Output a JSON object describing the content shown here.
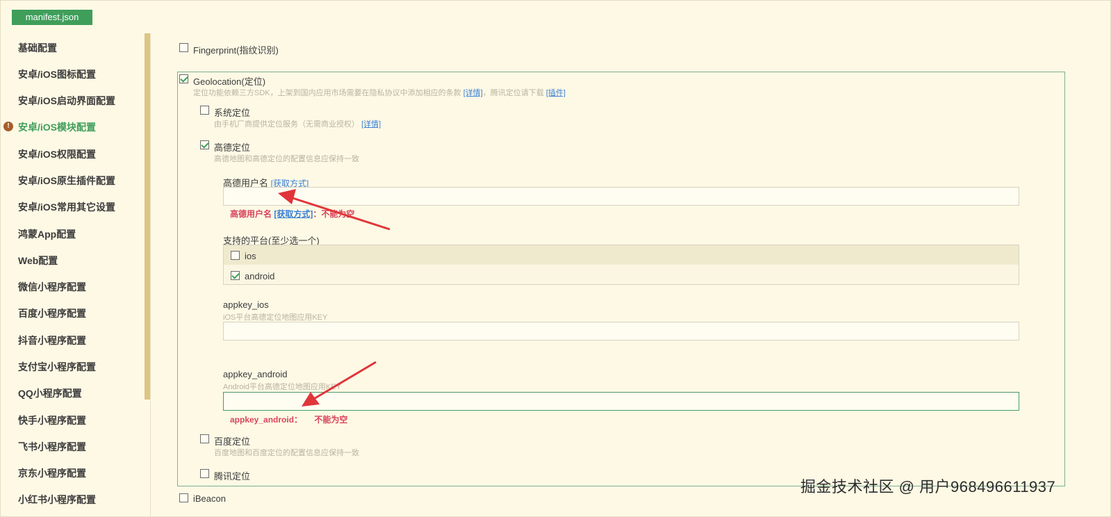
{
  "tab": {
    "label": "manifest.json"
  },
  "sidebar": {
    "items": [
      {
        "label": "基础配置"
      },
      {
        "label": "安卓/iOS图标配置"
      },
      {
        "label": "安卓/iOS启动界面配置"
      },
      {
        "label": "安卓/iOS模块配置",
        "active": true,
        "warning": "!"
      },
      {
        "label": "安卓/iOS权限配置"
      },
      {
        "label": "安卓/iOS原生插件配置"
      },
      {
        "label": "安卓/iOS常用其它设置"
      },
      {
        "label": "鸿蒙App配置"
      },
      {
        "label": "Web配置"
      },
      {
        "label": "微信小程序配置"
      },
      {
        "label": "百度小程序配置"
      },
      {
        "label": "抖音小程序配置"
      },
      {
        "label": "支付宝小程序配置"
      },
      {
        "label": "QQ小程序配置"
      },
      {
        "label": "快手小程序配置"
      },
      {
        "label": "飞书小程序配置"
      },
      {
        "label": "京东小程序配置"
      },
      {
        "label": "小红书小程序配置"
      }
    ]
  },
  "modules": {
    "fingerprint": {
      "label": "Fingerprint(指纹识别)",
      "checked": false
    },
    "geolocation": {
      "label": "Geolocation(定位)",
      "checked": true,
      "desc": "定位功能依赖三方SDK，上架到国内应用市场需要在隐私协议中添加相应的条款",
      "desc_link": "[详情]",
      "desc_mid": "，腾讯定位请下载",
      "desc_link2": "[插件]",
      "system": {
        "label": "系统定位",
        "checked": false,
        "desc": "由手机厂商提供定位服务（无需商业授权）",
        "desc_link": "[详情]"
      },
      "amap": {
        "label": "高德定位",
        "checked": true,
        "desc": "高德地图和高德定位的配置信息应保持一致",
        "username_label": "高德用户名",
        "username_link": "[获取方式]",
        "username_value": "",
        "username_error_prefix": "高德用户名",
        "username_error_link": "[获取方式]",
        "username_error_suffix": "：不能为空",
        "platforms_label": "支持的平台(至少选一个)",
        "platforms": [
          {
            "label": "ios",
            "checked": false
          },
          {
            "label": "android",
            "checked": true
          }
        ],
        "appkey_ios_label": "appkey_ios",
        "appkey_ios_desc": "iOS平台高德定位地图应用KEY",
        "appkey_ios_value": "",
        "appkey_android_label": "appkey_android",
        "appkey_android_desc": "Android平台高德定位地图应用KEY",
        "appkey_android_value": "",
        "appkey_android_error_prefix": "appkey_android：",
        "appkey_android_error_suffix": "不能为空"
      },
      "baidu": {
        "label": "百度定位",
        "checked": false,
        "desc": "百度地图和百度定位的配置信息应保持一致"
      },
      "tencent": {
        "label": "腾讯定位",
        "checked": false
      }
    },
    "ibeacon": {
      "label": "iBeacon",
      "checked": false
    }
  },
  "watermark": "掘金技术社区 @ 用户968496611937",
  "colors": {
    "accent": "#3f9e5a",
    "error": "#d9435a",
    "link": "#3a7fd6",
    "annotation": "#e0353a"
  }
}
